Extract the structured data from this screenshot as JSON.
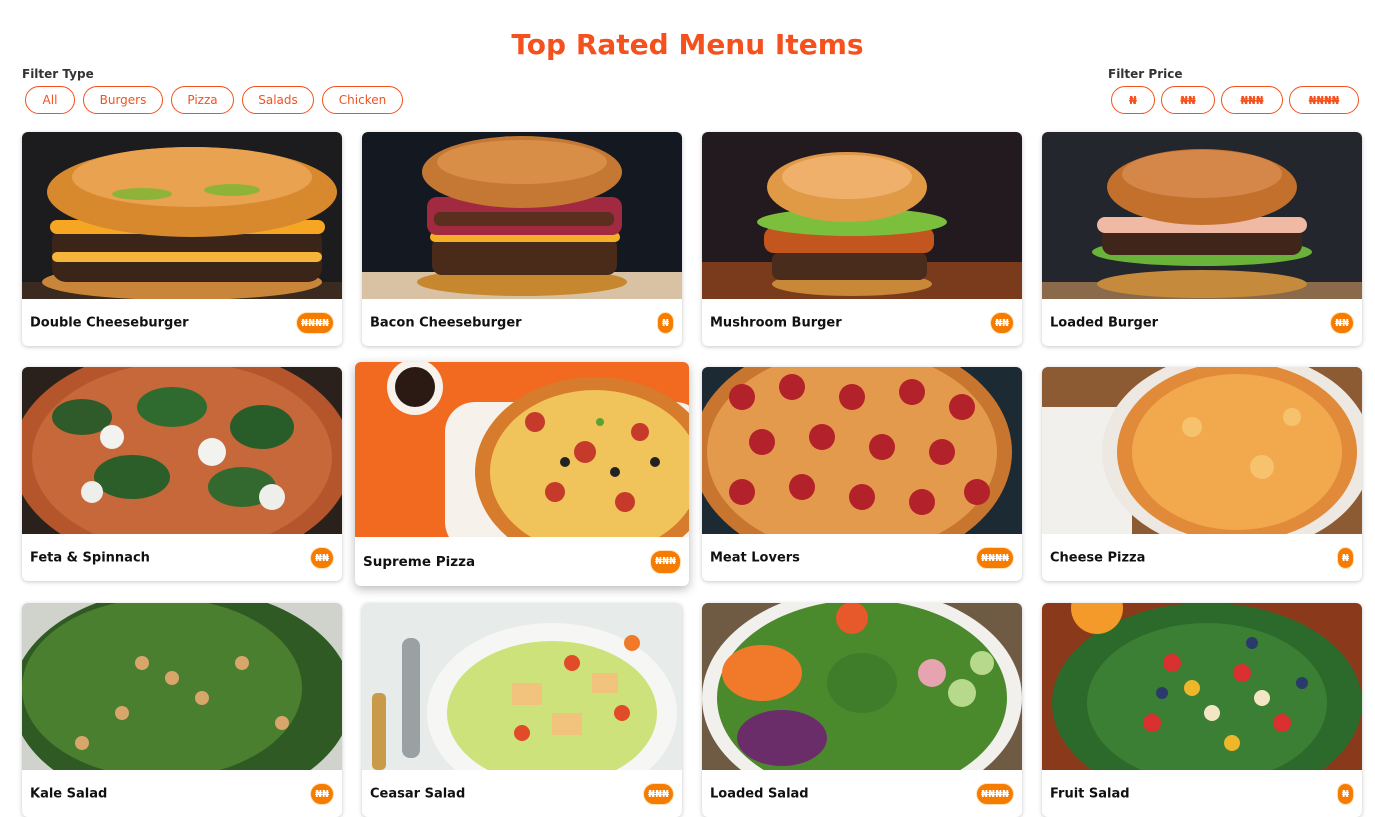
{
  "page_title": "Top Rated Menu Items",
  "filters": {
    "type_label": "Filter Type",
    "type_options": [
      "All",
      "Burgers",
      "Pizza",
      "Salads",
      "Chicken"
    ],
    "price_label": "Filter Price",
    "price_options": [
      "₦",
      "₦₦",
      "₦₦₦",
      "₦₦₦₦"
    ]
  },
  "colors": {
    "accent": "#f4511e",
    "badge": "#f57c00"
  },
  "items": [
    {
      "name": "Double Cheeseburger",
      "price": "₦₦₦₦",
      "category": "Burgers",
      "image": "burger-image"
    },
    {
      "name": "Bacon Cheeseburger",
      "price": "₦",
      "category": "Burgers",
      "image": "burger-image"
    },
    {
      "name": "Mushroom Burger",
      "price": "₦₦",
      "category": "Burgers",
      "image": "burger-image"
    },
    {
      "name": "Loaded Burger",
      "price": "₦₦",
      "category": "Burgers",
      "image": "burger-image"
    },
    {
      "name": "Feta & Spinnach",
      "price": "₦₦",
      "category": "Pizza",
      "image": "pizza-image"
    },
    {
      "name": "Supreme Pizza",
      "price": "₦₦₦",
      "category": "Pizza",
      "image": "pizza-image"
    },
    {
      "name": "Meat Lovers",
      "price": "₦₦₦₦",
      "category": "Pizza",
      "image": "pizza-image"
    },
    {
      "name": "Cheese Pizza",
      "price": "₦",
      "category": "Pizza",
      "image": "pizza-image"
    },
    {
      "name": "Kale Salad",
      "price": "₦₦",
      "category": "Salads",
      "image": "salad-image"
    },
    {
      "name": "Ceasar Salad",
      "price": "₦₦₦",
      "category": "Salads",
      "image": "salad-image"
    },
    {
      "name": "Loaded Salad",
      "price": "₦₦₦₦",
      "category": "Salads",
      "image": "salad-image"
    },
    {
      "name": "Fruit Salad",
      "price": "₦",
      "category": "Salads",
      "image": "salad-image"
    }
  ]
}
